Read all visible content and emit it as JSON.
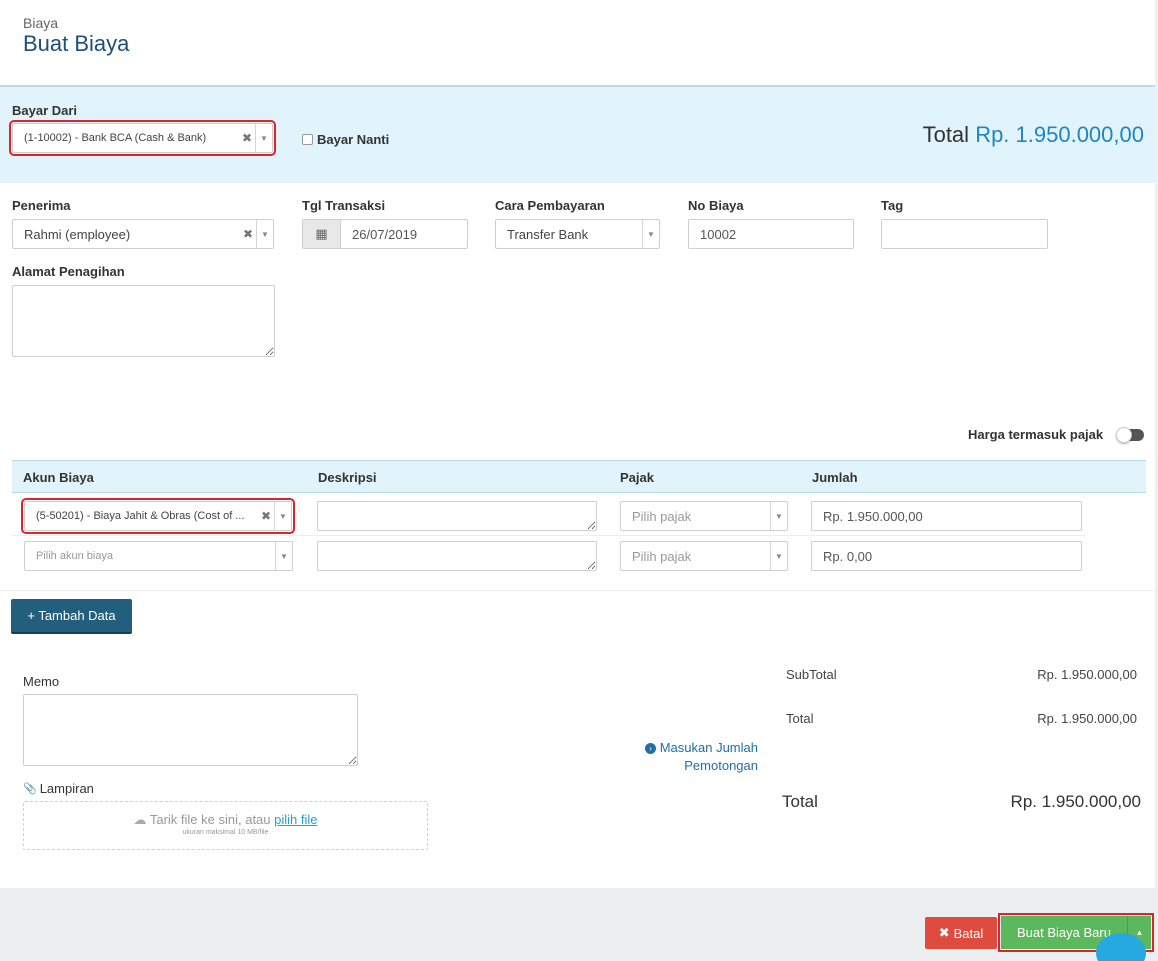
{
  "header": {
    "breadcrumb": "Biaya",
    "title": "Buat Biaya"
  },
  "pay_from": {
    "label": "Bayar Dari",
    "value": "(1-10002) - Bank BCA (Cash & Bank)",
    "pay_later_label": "Bayar Nanti",
    "total_label": "Total",
    "total_amount": "Rp. 1.950.000,00"
  },
  "form": {
    "recipient_label": "Penerima",
    "recipient_value": "Rahmi (employee)",
    "date_label": "Tgl Transaksi",
    "date_value": "26/07/2019",
    "payment_label": "Cara Pembayaran",
    "payment_value": "Transfer Bank",
    "number_label": "No Biaya",
    "number_value": "10002",
    "tag_label": "Tag",
    "tag_value": "",
    "address_label": "Alamat Penagihan"
  },
  "tax_toggle_label": "Harga termasuk pajak",
  "table": {
    "headers": [
      "Akun Biaya",
      "Deskripsi",
      "Pajak",
      "Jumlah"
    ],
    "rows": [
      {
        "account": "(5-50201) - Biaya Jahit & Obras (Cost of ...",
        "tax": "Pilih pajak",
        "amount": "Rp. 1.950.000,00"
      },
      {
        "account": "Pilih akun biaya",
        "tax": "Pilih pajak",
        "amount": "Rp. 0,00"
      }
    ]
  },
  "add_row_label": "+ Tambah Data",
  "memo_label": "Memo",
  "attachment": {
    "label": "Lampiran",
    "drop_text": "Tarik file ke sini, atau",
    "pick_link": "pilih file",
    "limit_text": "ukuran maksimal 10 MB/file"
  },
  "summary": {
    "subtotal_label": "SubTotal",
    "subtotal_value": "Rp. 1.950.000,00",
    "total_label": "Total",
    "total_value": "Rp. 1.950.000,00",
    "deduction_link_1": "Masukan Jumlah",
    "deduction_link_2": "Pemotongan",
    "grand_total_label": "Total",
    "grand_total_value": "Rp. 1.950.000,00"
  },
  "footer": {
    "cancel_label": "Batal",
    "save_label": "Buat Biaya Baru"
  },
  "colors": {
    "accent": "#1f85c6",
    "band": "#e1f3fb",
    "primary_button": "#215f7d",
    "danger": "#e04b3f",
    "success": "#5cb85c"
  }
}
